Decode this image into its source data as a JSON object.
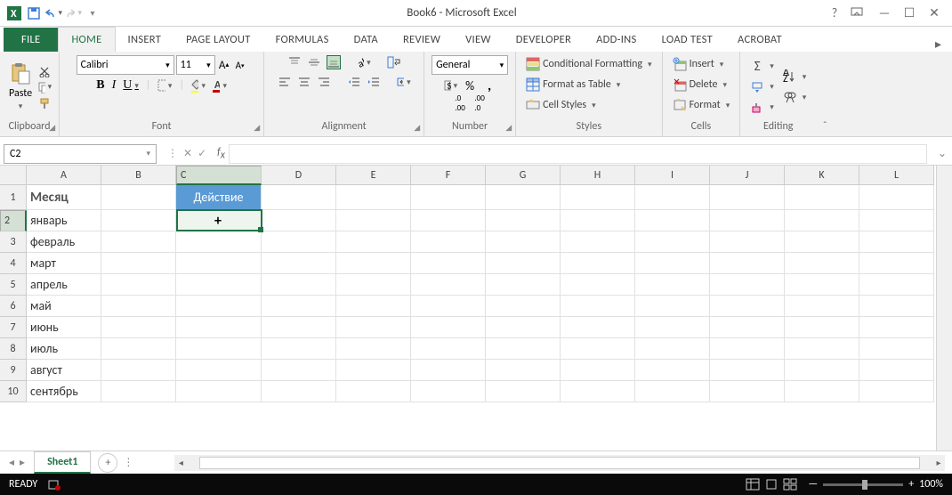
{
  "title": "Book6 - Microsoft Excel",
  "tabs": {
    "file": "FILE",
    "home": "HOME",
    "insert": "INSERT",
    "pagelayout": "PAGE LAYOUT",
    "formulas": "FORMULAS",
    "data": "DATA",
    "review": "REVIEW",
    "view": "VIEW",
    "developer": "DEVELOPER",
    "addins": "ADD-INS",
    "loadtest": "LOAD TEST",
    "acrobat": "ACROBAT"
  },
  "groups": {
    "clipboard": "Clipboard",
    "font": "Font",
    "alignment": "Alignment",
    "number": "Number",
    "styles": "Styles",
    "cells": "Cells",
    "editing": "Editing"
  },
  "clipboard": {
    "paste": "Paste"
  },
  "font": {
    "name": "Calibri",
    "size": "11"
  },
  "number": {
    "format": "General"
  },
  "styles": {
    "cond": "Conditional Formatting",
    "table": "Format as Table",
    "cell": "Cell Styles"
  },
  "cellsg": {
    "insert": "Insert",
    "delete": "Delete",
    "format": "Format"
  },
  "namebox": "C2",
  "columns": [
    "A",
    "B",
    "C",
    "D",
    "E",
    "F",
    "G",
    "H",
    "I",
    "J",
    "K",
    "L"
  ],
  "rows": [
    "1",
    "2",
    "3",
    "4",
    "5",
    "6",
    "7",
    "8",
    "9",
    "10"
  ],
  "data": {
    "A1": "Месяц",
    "C1": "Действие",
    "A2": "январь",
    "A3": "февраль",
    "A4": "март",
    "A5": "апрель",
    "A6": "май",
    "A7": "июнь",
    "A8": "июль",
    "A9": "август",
    "A10": "сентябрь"
  },
  "sheet": "Sheet1",
  "status": {
    "ready": "READY",
    "zoom": "100%"
  }
}
